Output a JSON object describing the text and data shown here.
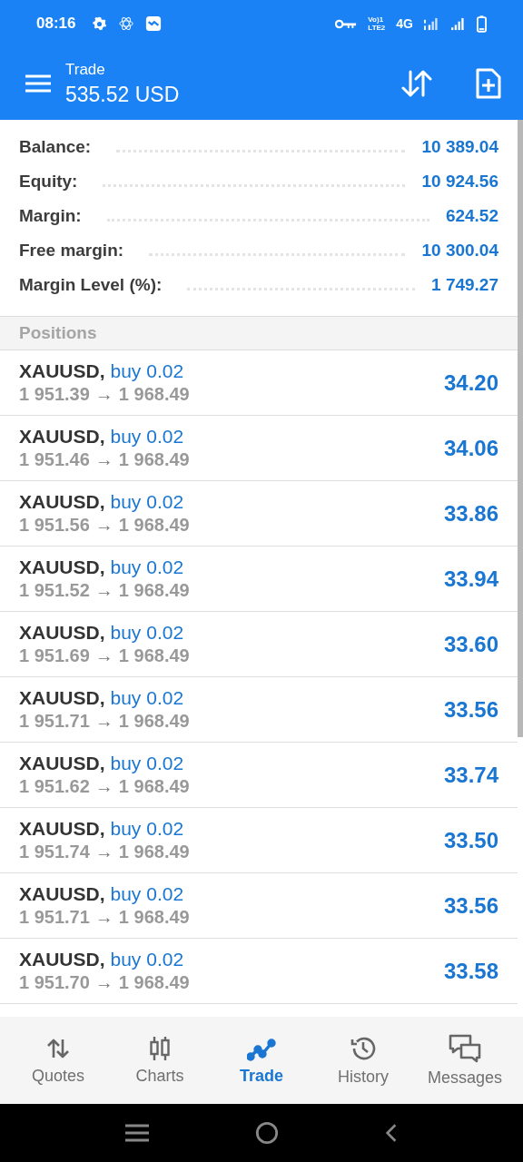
{
  "status_bar": {
    "time": "08:16",
    "volte": [
      "Vo)1",
      "LTE2"
    ],
    "network": "4G"
  },
  "header": {
    "title": "Trade",
    "subtitle": "535.52 USD"
  },
  "summary": [
    {
      "label": "Balance:",
      "value": "10 389.04"
    },
    {
      "label": "Equity:",
      "value": "10 924.56"
    },
    {
      "label": "Margin:",
      "value": "624.52"
    },
    {
      "label": "Free margin:",
      "value": "10 300.04"
    },
    {
      "label": "Margin Level (%):",
      "value": "1 749.27"
    }
  ],
  "positions_title": "Positions",
  "positions": [
    {
      "symbol": "XAUUSD,",
      "side": "buy 0.02",
      "open": "1 951.39",
      "current": "1 968.49",
      "profit": "34.20"
    },
    {
      "symbol": "XAUUSD,",
      "side": "buy 0.02",
      "open": "1 951.46",
      "current": "1 968.49",
      "profit": "34.06"
    },
    {
      "symbol": "XAUUSD,",
      "side": "buy 0.02",
      "open": "1 951.56",
      "current": "1 968.49",
      "profit": "33.86"
    },
    {
      "symbol": "XAUUSD,",
      "side": "buy 0.02",
      "open": "1 951.52",
      "current": "1 968.49",
      "profit": "33.94"
    },
    {
      "symbol": "XAUUSD,",
      "side": "buy 0.02",
      "open": "1 951.69",
      "current": "1 968.49",
      "profit": "33.60"
    },
    {
      "symbol": "XAUUSD,",
      "side": "buy 0.02",
      "open": "1 951.71",
      "current": "1 968.49",
      "profit": "33.56"
    },
    {
      "symbol": "XAUUSD,",
      "side": "buy 0.02",
      "open": "1 951.62",
      "current": "1 968.49",
      "profit": "33.74"
    },
    {
      "symbol": "XAUUSD,",
      "side": "buy 0.02",
      "open": "1 951.74",
      "current": "1 968.49",
      "profit": "33.50"
    },
    {
      "symbol": "XAUUSD,",
      "side": "buy 0.02",
      "open": "1 951.71",
      "current": "1 968.49",
      "profit": "33.56"
    },
    {
      "symbol": "XAUUSD,",
      "side": "buy 0.02",
      "open": "1 951.70",
      "current": "1 968.49",
      "profit": "33.58"
    }
  ],
  "arrow": "→",
  "tabs": [
    {
      "kind": "quotes",
      "label": "Quotes",
      "selected": false
    },
    {
      "kind": "charts",
      "label": "Charts",
      "selected": false
    },
    {
      "kind": "trade",
      "label": "Trade",
      "selected": true
    },
    {
      "kind": "history",
      "label": "History",
      "selected": false
    },
    {
      "kind": "messages",
      "label": "Messages",
      "selected": false
    }
  ]
}
